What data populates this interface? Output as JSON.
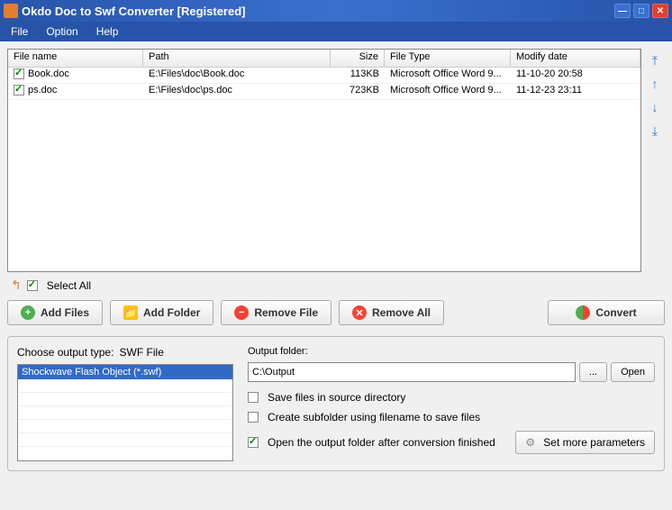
{
  "window": {
    "title": "Okdo Doc to Swf Converter [Registered]"
  },
  "menu": {
    "file": "File",
    "option": "Option",
    "help": "Help"
  },
  "columns": {
    "name": "File name",
    "path": "Path",
    "size": "Size",
    "type": "File Type",
    "date": "Modify date"
  },
  "files": [
    {
      "checked": true,
      "name": "Book.doc",
      "path": "E:\\Files\\doc\\Book.doc",
      "size": "113KB",
      "type": "Microsoft Office Word 9...",
      "date": "11-10-20 20:58"
    },
    {
      "checked": true,
      "name": "ps.doc",
      "path": "E:\\Files\\doc\\ps.doc",
      "size": "723KB",
      "type": "Microsoft Office Word 9...",
      "date": "11-12-23 23:11"
    }
  ],
  "selectAll": {
    "label": "Select All",
    "checked": true
  },
  "buttons": {
    "addFiles": "Add Files",
    "addFolder": "Add Folder",
    "removeFile": "Remove File",
    "removeAll": "Remove All",
    "convert": "Convert"
  },
  "outputType": {
    "label": "Choose output type:",
    "current": "SWF File",
    "item": "Shockwave Flash Object (*.swf)"
  },
  "outputFolder": {
    "label": "Output folder:",
    "value": "C:\\Output",
    "browse": "...",
    "open": "Open"
  },
  "options": {
    "saveSource": {
      "label": "Save files in source directory",
      "checked": false
    },
    "subfolder": {
      "label": "Create subfolder using filename to save files",
      "checked": false
    },
    "openAfter": {
      "label": "Open the output folder after conversion finished",
      "checked": true
    }
  },
  "params": {
    "label": "Set more parameters"
  }
}
